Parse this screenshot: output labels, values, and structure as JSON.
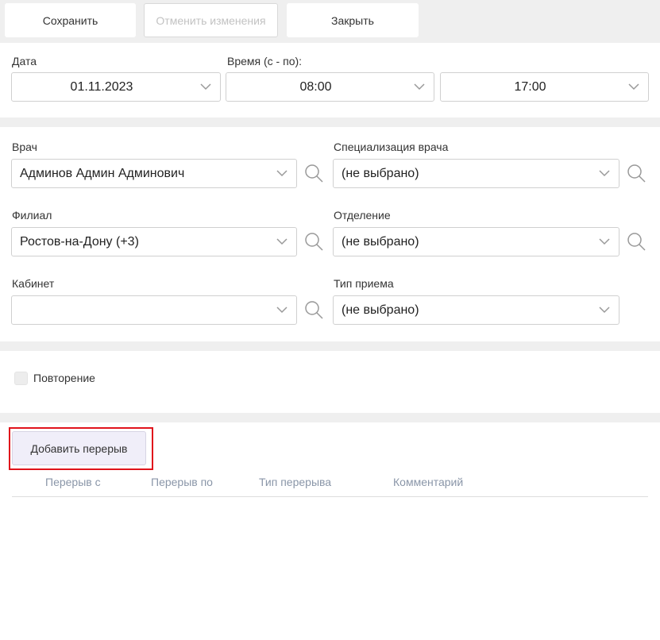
{
  "toolbar": {
    "save_label": "Сохранить",
    "cancel_label": "Отменить изменения",
    "close_label": "Закрыть"
  },
  "datetime": {
    "date_label": "Дата",
    "date_value": "01.11.2023",
    "time_label": "Время (с - по):",
    "time_from": "08:00",
    "time_to": "17:00"
  },
  "form": {
    "doctor_label": "Врач",
    "doctor_value": "Админов Админ Админович",
    "specialization_label": "Специализация врача",
    "specialization_value": "(не выбрано)",
    "branch_label": "Филиал",
    "branch_value": "Ростов-на-Дону (+3)",
    "department_label": "Отделение",
    "department_value": "(не выбрано)",
    "cabinet_label": "Кабинет",
    "cabinet_value": "",
    "appointment_type_label": "Тип приема",
    "appointment_type_value": "(не выбрано)"
  },
  "repeat": {
    "label": "Повторение",
    "checked": false
  },
  "breaks": {
    "add_button_label": "Добавить перерыв",
    "columns": [
      "Перерыв с",
      "Перерыв по",
      "Тип перерыва",
      "Комментарий"
    ],
    "rows": []
  },
  "colors": {
    "highlight": "#e0131b",
    "header_text": "#8a96a8",
    "section_bg": "#efefef"
  }
}
